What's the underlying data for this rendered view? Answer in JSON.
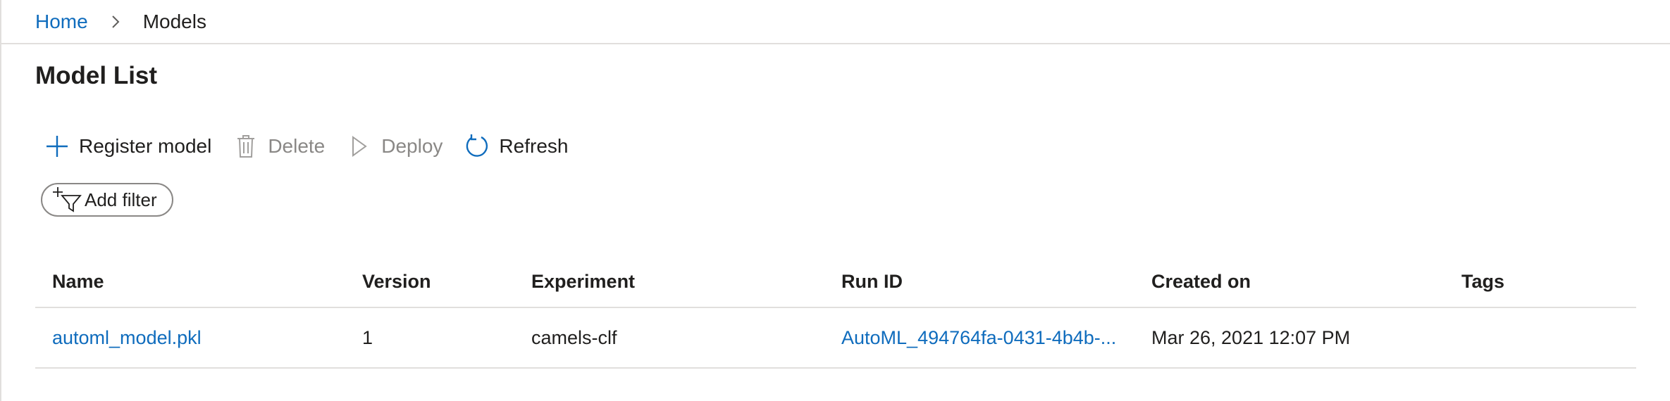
{
  "breadcrumb": {
    "home": "Home",
    "current": "Models"
  },
  "page": {
    "title": "Model List"
  },
  "toolbar": {
    "register": {
      "label": "Register model",
      "icon": "plus-icon"
    },
    "delete": {
      "label": "Delete",
      "icon": "trash-icon",
      "disabled": true
    },
    "deploy": {
      "label": "Deploy",
      "icon": "play-icon",
      "disabled": true
    },
    "refresh": {
      "label": "Refresh",
      "icon": "refresh-icon"
    }
  },
  "filter": {
    "label": "Add filter",
    "icon": "add-filter-icon"
  },
  "table": {
    "columns": [
      "Name",
      "Version",
      "Experiment",
      "Run ID",
      "Created on",
      "Tags"
    ],
    "rows": [
      {
        "name": "automl_model.pkl",
        "version": "1",
        "experiment": "camels-clf",
        "run_id": "AutoML_494764fa-0431-4b4b-...",
        "created_on": "Mar 26, 2021 12:07 PM",
        "tags": ""
      }
    ]
  },
  "colors": {
    "accent": "#0f6cbd",
    "text": "#201f1e",
    "disabled": "#8a8886",
    "divider": "#e1dfdd"
  }
}
